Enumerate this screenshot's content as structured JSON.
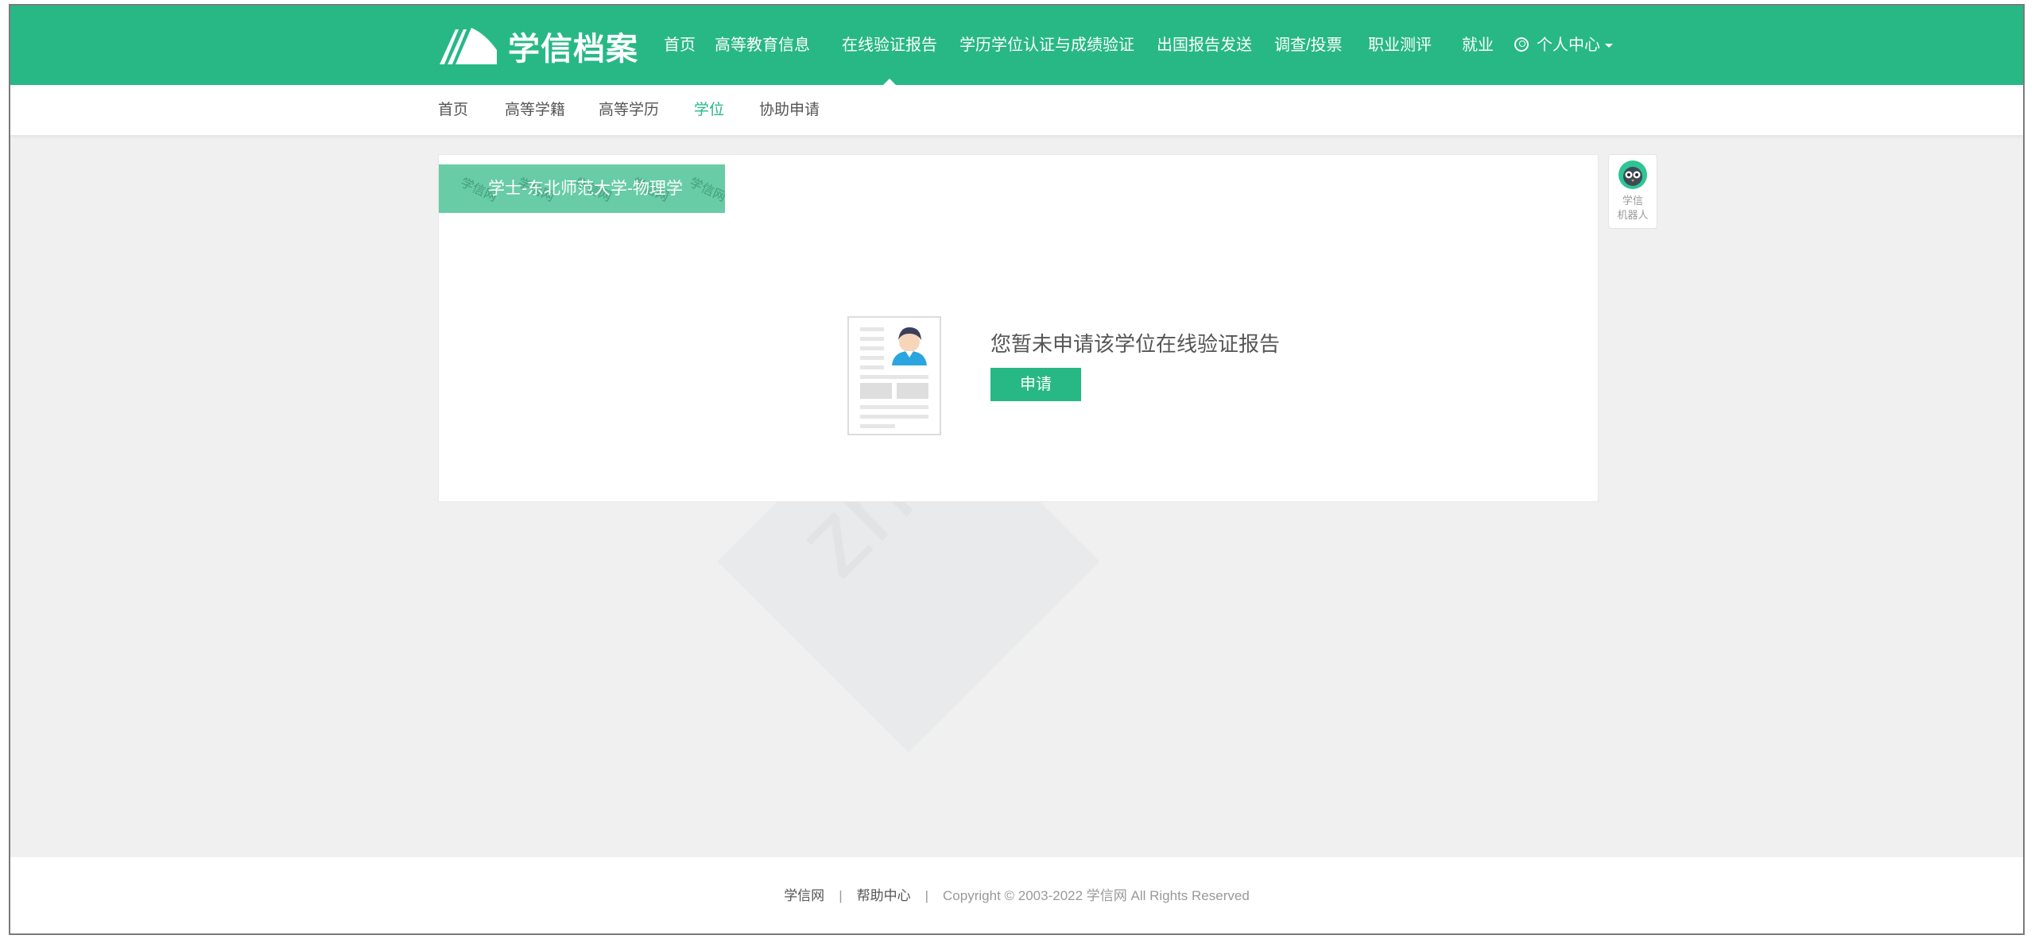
{
  "brand": {
    "name": "学信档案"
  },
  "nav": {
    "items": [
      {
        "label": "首页"
      },
      {
        "label": "高等教育信息"
      },
      {
        "label": "在线验证报告"
      },
      {
        "label": "学历学位认证与成绩验证"
      },
      {
        "label": "出国报告发送"
      },
      {
        "label": "调查/投票"
      },
      {
        "label": "职业测评"
      },
      {
        "label": "就业"
      }
    ],
    "user_center": "个人中心"
  },
  "subnav": {
    "items": [
      {
        "label": "首页"
      },
      {
        "label": "高等学籍"
      },
      {
        "label": "高等学历"
      },
      {
        "label": "学位"
      },
      {
        "label": "协助申请"
      }
    ]
  },
  "card": {
    "tag": "学士-东北师范大学-物理学",
    "tag_watermark": "学信网",
    "empty_message": "您暂未申请该学位在线验证报告",
    "apply_label": "申请"
  },
  "robot": {
    "line1": "学信",
    "line2": "机器人"
  },
  "watermark": "zhaozhao",
  "footer": {
    "link1": "学信网",
    "link2": "帮助中心",
    "separator": "|",
    "copyright_prefix": "Copyright © 2003-2022 ",
    "copyright_brand": "学信网",
    "copyright_suffix": " All Rights Reserved"
  },
  "colors": {
    "primary": "#27b886",
    "tag_bg": "#68cca6",
    "page_bg": "#f0f0f0"
  }
}
